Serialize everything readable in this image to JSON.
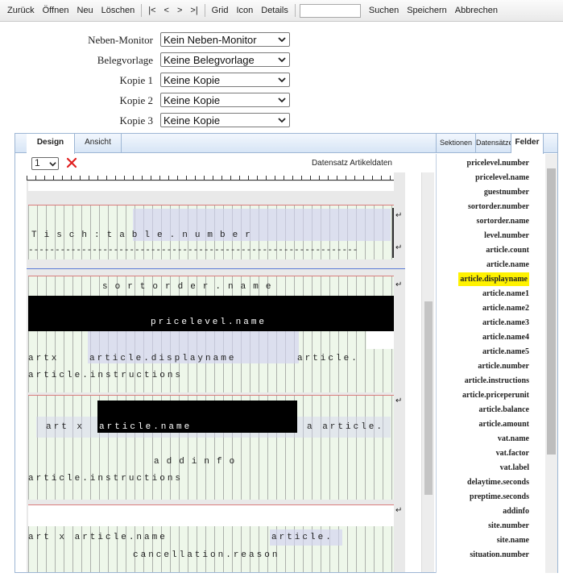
{
  "toolbar": {
    "back": "Zurück",
    "open": "Öffnen",
    "new": "Neu",
    "delete": "Löschen",
    "first": "|<",
    "prev": "<",
    "next": ">",
    "last": ">|",
    "grid": "Grid",
    "icon": "Icon",
    "details": "Details",
    "search_value": "",
    "search": "Suchen",
    "save": "Speichern",
    "cancel": "Abbrechen"
  },
  "form": {
    "rows": [
      {
        "label": "Neben-Monitor",
        "value": "Kein Neben-Monitor"
      },
      {
        "label": "Belegvorlage",
        "value": "Keine Belegvorlage"
      },
      {
        "label": "Kopie 1",
        "value": "Keine Kopie"
      },
      {
        "label": "Kopie 2",
        "value": "Keine Kopie"
      },
      {
        "label": "Kopie 3",
        "value": "Keine Kopie"
      }
    ]
  },
  "tabs": {
    "design": "Design",
    "view": "Ansicht",
    "sections": "Sektionen",
    "records": "Datensätze",
    "fields": "Felder"
  },
  "design": {
    "page_value": "1",
    "record_label": "Datensatz Artikeldaten",
    "return_mark": "↵",
    "bands": {
      "table": "Tisch:table.number",
      "dashes": "--------------------------------------------------------------",
      "sortorder": "sortorder.name",
      "pricelevel": "pricelevel.name",
      "artx": "artx",
      "article_displayname": "article.displayname",
      "article_dot": "article.",
      "instructions": "article.instructions",
      "art_x": "art x",
      "article_name": "article.name",
      "a_article": "a article.",
      "addinfo": "addinfo",
      "instructions2": "article.instructions",
      "art_x_article_name": "art x article.name",
      "article_dot2": "article.",
      "cancellation": "cancellation.reason"
    }
  },
  "fields": [
    "pricelevel.number",
    "pricelevel.name",
    "guestnumber",
    "sortorder.number",
    "sortorder.name",
    "level.number",
    "article.count",
    "article.name",
    "article.displayname",
    "article.name1",
    "article.name2",
    "article.name3",
    "article.name4",
    "article.name5",
    "article.number",
    "article.instructions",
    "article.priceperunit",
    "article.balance",
    "article.amount",
    "vat.name",
    "vat.factor",
    "vat.label",
    "delaytime.seconds",
    "preptime.seconds",
    "addinfo",
    "site.number",
    "site.name",
    "situation.number"
  ],
  "highlighted_field": "article.displayname",
  "colors": {
    "highlight": "#fff200",
    "band_bg": "#eef7ea",
    "accent_blue": "#9db6d4"
  }
}
